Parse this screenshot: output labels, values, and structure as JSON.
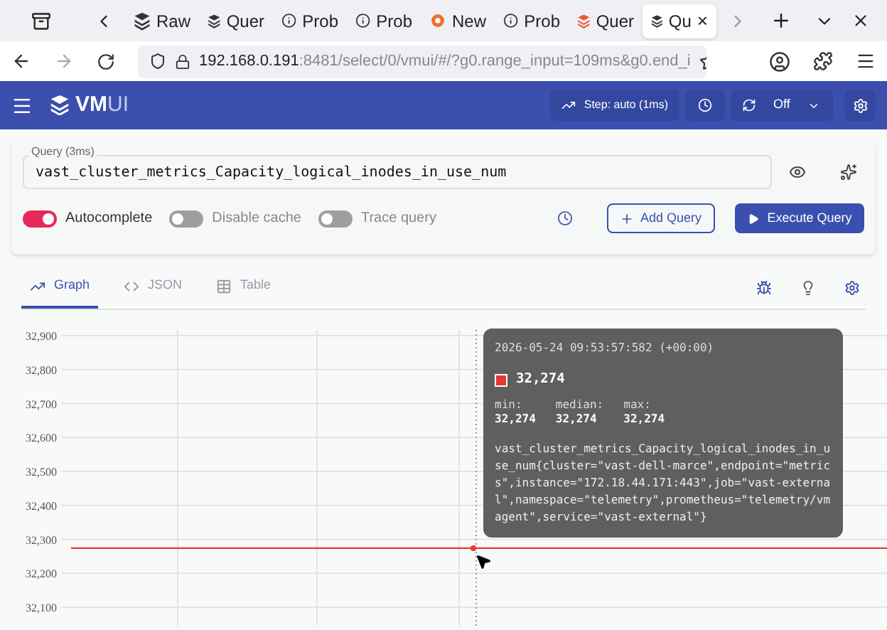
{
  "browser_tabs": [
    {
      "kind": "vm",
      "label": "Raw",
      "selected": false
    },
    {
      "kind": "vm",
      "label": "Quer",
      "selected": false
    },
    {
      "kind": "info",
      "label": "Prob",
      "selected": false
    },
    {
      "kind": "info",
      "label": "Prob",
      "selected": false
    },
    {
      "kind": "grafana",
      "label": "New",
      "selected": false
    },
    {
      "kind": "info",
      "label": "Prob",
      "selected": false
    },
    {
      "kind": "vm-orange",
      "label": "Quer",
      "selected": false
    },
    {
      "kind": "vm",
      "label": "Qu",
      "selected": true,
      "close": "×"
    }
  ],
  "address_bar": {
    "host": "192.168.0.191",
    "path": ":8481/select/0/vmui/#/?g0.range_input=109ms&g0.end_i"
  },
  "header": {
    "logo_bold": "VM",
    "logo_light": "UI",
    "step": "Step: auto (1ms)",
    "refresh": "Off"
  },
  "query": {
    "label": "Query (3ms)",
    "value": "vast_cluster_metrics_Capacity_logical_inodes_in_use_num"
  },
  "toggles": [
    {
      "label": "Autocomplete",
      "on": true
    },
    {
      "label": "Disable cache",
      "on": false
    },
    {
      "label": "Trace query",
      "on": false
    }
  ],
  "buttons": {
    "add": "Add Query",
    "execute": "Execute Query"
  },
  "view_tabs": [
    {
      "kind": "graph",
      "label": "Graph",
      "selected": true
    },
    {
      "kind": "json",
      "label": "JSON",
      "selected": false
    },
    {
      "kind": "table",
      "label": "Table",
      "selected": false
    }
  ],
  "graph": {
    "chart_data": {
      "type": "line",
      "grid": true,
      "series": [
        {
          "name": "vast_cluster_metrics_Capacity_logical_inodes_in_use_num",
          "color": "#e53935",
          "values": [
            32274,
            32274,
            32274,
            32274
          ]
        }
      ],
      "ylim": [
        32100,
        32900
      ],
      "yticks": [
        {
          "value": 32100,
          "label": "32,100"
        },
        {
          "value": 32200,
          "label": "32,200"
        },
        {
          "value": 32300,
          "label": "32,300"
        },
        {
          "value": 32400,
          "label": "32,400"
        },
        {
          "value": 32500,
          "label": "32,500"
        },
        {
          "value": 32600,
          "label": "32,600"
        },
        {
          "value": 32700,
          "label": "32,700"
        },
        {
          "value": 32800,
          "label": "32,800"
        },
        {
          "value": 32900,
          "label": "32,900"
        }
      ]
    },
    "tooltip": {
      "time": "2026-05-24 09:53:57:582 (+00:00)",
      "color": "#e53935",
      "value": "32,274",
      "stats": [
        {
          "label": "min:",
          "value": "32,274"
        },
        {
          "label": "median:",
          "value": "32,274"
        },
        {
          "label": "max:",
          "value": "32,274"
        }
      ],
      "series_labels": "{cluster=\"vast-dell-marce\",endpoint=\"metrics\",instance=\"172.18.44.171:443\",job=\"vast-external\",namespace=\"telemetry\",prometheus=\"telemetry/vmagent\",service=\"vast-external\"}"
    }
  }
}
